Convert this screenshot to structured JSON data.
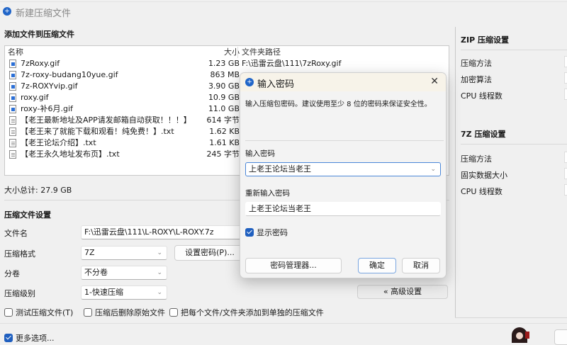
{
  "window": {
    "title": "新建压缩文件"
  },
  "files_section": {
    "title": "添加文件到压缩文件",
    "columns": {
      "name": "名称",
      "size": "大小",
      "path": "文件夹路径"
    },
    "files": [
      {
        "name": "7zRoxy.gif",
        "size": "1.23 GB",
        "path": "F:\\迅雷云盘\\111\\7zRoxy.gif",
        "type": "image"
      },
      {
        "name": "7z-roxy-budang10yue.gif",
        "size": "863 MB",
        "type": "image"
      },
      {
        "name": "7z-ROXYvip.gif",
        "size": "3.90 GB",
        "type": "image"
      },
      {
        "name": "roxy.gif",
        "size": "10.9 GB",
        "type": "image"
      },
      {
        "name": "roxy-补6月.gif",
        "size": "11.0 GB",
        "type": "image"
      },
      {
        "name": "【老王最新地址及APP请发邮箱自动获取！！！】....",
        "size": "614 字节",
        "type": "text"
      },
      {
        "name": "【老王来了就能下载和观看！纯免费！】.txt",
        "size": "1.62 KB",
        "type": "text"
      },
      {
        "name": "【老王论坛介绍】.txt",
        "size": "1.61 KB",
        "type": "text"
      },
      {
        "name": "【老王永久地址发布页】.txt",
        "size": "245 字节",
        "type": "text"
      }
    ],
    "total": "大小总计: 27.9 GB"
  },
  "settings": {
    "title": "压缩文件设置",
    "filename_label": "文件名",
    "filename_value": "F:\\迅雷云盘\\111\\L-ROXY\\L-ROXY.7z",
    "format_label": "压缩格式",
    "format_value": "7Z",
    "set_password": "设置密码(P)...",
    "split_label": "分卷",
    "split_value": "不分卷",
    "level_label": "压缩级别",
    "level_value": "1-快速压缩",
    "test_archive": "测试压缩文件(T)",
    "delete_after": "压缩后删除原始文件",
    "separate": "把每个文件/文件夹添加到单独的压缩文件",
    "advanced": "« 高级设置",
    "more_options": "更多选项..."
  },
  "right_panel": {
    "zip_title": "ZIP 压缩设置",
    "zip_rows": [
      "压缩方法",
      "加密算法",
      "CPU 线程数"
    ],
    "7z_title": "7Z 压缩设置",
    "7z_rows": [
      "压缩方法",
      "固实数据大小",
      "CPU 线程数"
    ]
  },
  "dialog": {
    "title": "输入密码",
    "description": "输入压缩包密码。建议使用至少 8 位的密码来保证安全性。",
    "password_label": "输入密码",
    "password_value": "上老王论坛当老王",
    "confirm_label": "重新输入密码",
    "confirm_value": "上老王论坛当老王",
    "show_password": "显示密码",
    "manager": "密码管理器...",
    "ok": "确定",
    "cancel": "取消"
  },
  "colors": {
    "accent": "#1f5fbf"
  }
}
